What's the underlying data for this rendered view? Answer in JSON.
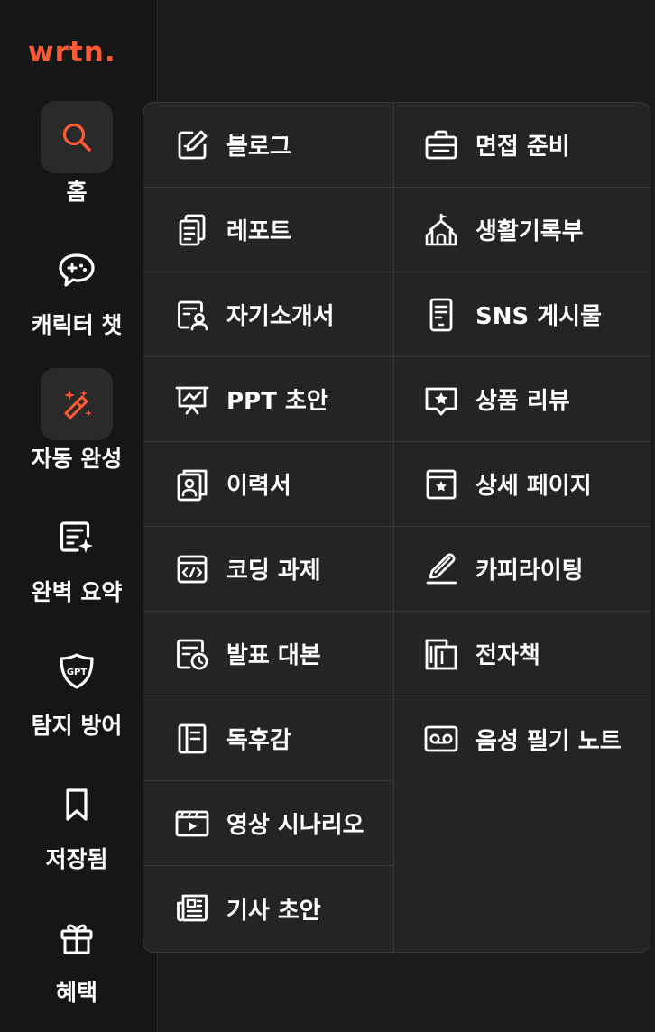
{
  "app": {
    "logo_text": "wrtn.",
    "brand_color": "#ff5a36"
  },
  "sidebar": {
    "items": [
      {
        "label": "홈",
        "icon": "search-icon",
        "active": true
      },
      {
        "label": "캐릭터 챗",
        "icon": "game-chat-icon",
        "active": false
      },
      {
        "label": "자동 완성",
        "icon": "magic-wand-icon",
        "active": true
      },
      {
        "label": "완벽 요약",
        "icon": "document-sparkle-icon",
        "active": false
      },
      {
        "label": "탐지 방어",
        "icon": "gpt-shield-icon",
        "active": false
      },
      {
        "label": "저장됨",
        "icon": "bookmark-icon",
        "active": false
      },
      {
        "label": "혜택",
        "icon": "gift-icon",
        "active": false
      }
    ]
  },
  "menu": {
    "left": [
      {
        "label": "블로그",
        "icon": "edit-note-icon"
      },
      {
        "label": "레포트",
        "icon": "copy-document-icon"
      },
      {
        "label": "자기소개서",
        "icon": "profile-document-icon"
      },
      {
        "label": "PPT 초안",
        "icon": "presentation-icon"
      },
      {
        "label": "이력서",
        "icon": "resume-icon"
      },
      {
        "label": "코딩 과제",
        "icon": "code-window-icon"
      },
      {
        "label": "발표 대본",
        "icon": "document-clock-icon"
      },
      {
        "label": "독후감",
        "icon": "book-icon"
      },
      {
        "label": "영상 시나리오",
        "icon": "video-icon"
      },
      {
        "label": "기사 초안",
        "icon": "newspaper-icon"
      }
    ],
    "right": [
      {
        "label": "면접 준비",
        "icon": "briefcase-icon"
      },
      {
        "label": "생활기록부",
        "icon": "school-icon"
      },
      {
        "label": "SNS 게시물",
        "icon": "phone-icon"
      },
      {
        "label": "상품 리뷰",
        "icon": "star-review-icon"
      },
      {
        "label": "상세 페이지",
        "icon": "store-page-icon"
      },
      {
        "label": "카피라이팅",
        "icon": "pen-icon"
      },
      {
        "label": "전자책",
        "icon": "ebook-icon"
      },
      {
        "label": "음성 필기 노트",
        "icon": "voicemail-icon"
      }
    ]
  }
}
